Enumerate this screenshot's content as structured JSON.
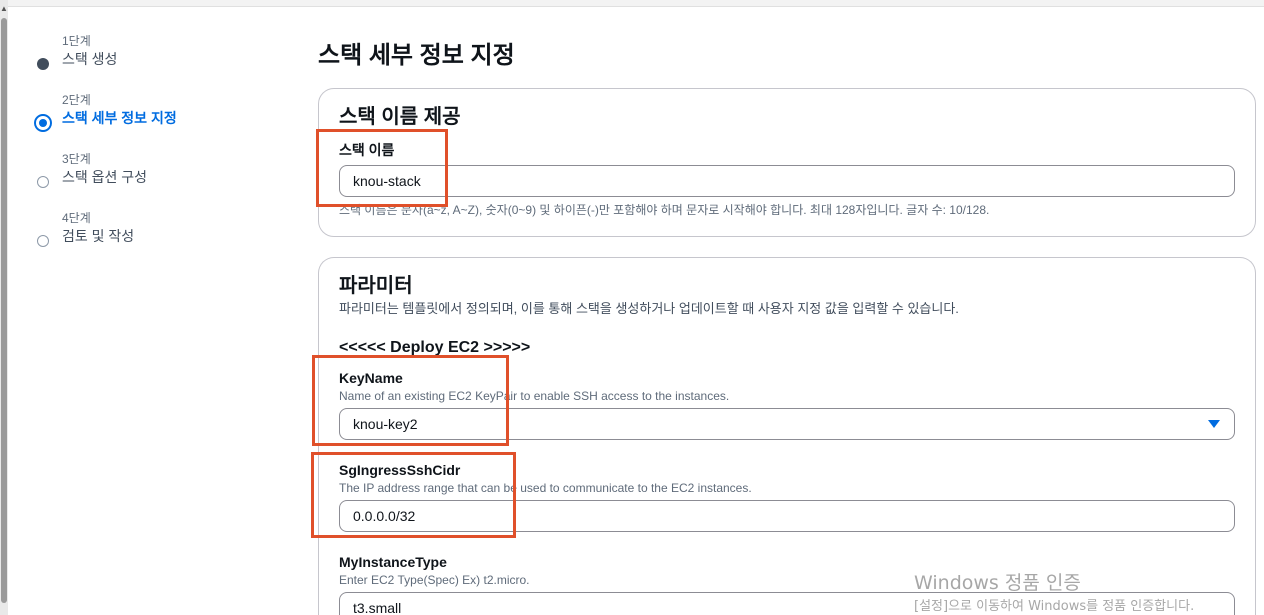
{
  "wizard": {
    "steps": [
      {
        "num": "1단계",
        "title": "스택 생성",
        "state": "done"
      },
      {
        "num": "2단계",
        "title": "스택 세부 정보 지정",
        "state": "active"
      },
      {
        "num": "3단계",
        "title": "스택 옵션 구성",
        "state": "todo"
      },
      {
        "num": "4단계",
        "title": "검토 및 작성",
        "state": "todo"
      }
    ]
  },
  "page": {
    "title": "스택 세부 정보 지정"
  },
  "stack_name_panel": {
    "title": "스택 이름 제공",
    "field_label": "스택 이름",
    "value": "knou-stack",
    "hint": "스택 이름은 문자(a~z, A~Z), 숫자(0~9) 및 하이픈(-)만 포함해야 하며 문자로 시작해야 합니다. 최대 128자입니다. 글자 수: 10/128."
  },
  "parameters_panel": {
    "title": "파라미터",
    "description": "파라미터는 템플릿에서 정의되며, 이를 통해 스택을 생성하거나 업데이트할 때 사용자 지정 값을 입력할 수 있습니다.",
    "section": "<<<<< Deploy EC2 >>>>>",
    "key_name": {
      "label": "KeyName",
      "desc": "Name of an existing EC2 KeyPair to enable SSH access to the instances.",
      "value": "knou-key2"
    },
    "sg_ingress": {
      "label": "SgIngressSshCidr",
      "desc": "The IP address range that can be used to communicate to the EC2 instances.",
      "value": "0.0.0.0/32"
    },
    "instance_type": {
      "label": "MyInstanceType",
      "desc": "Enter EC2 Type(Spec) Ex) t2.micro.",
      "value": "t3.small"
    }
  },
  "watermark": {
    "line1": "Windows 정품 인증",
    "line2": "[설정]으로 이동하여 Windows를 정품 인증합니다."
  },
  "colors": {
    "accent": "#006ce0",
    "highlight": "#e0502a"
  }
}
